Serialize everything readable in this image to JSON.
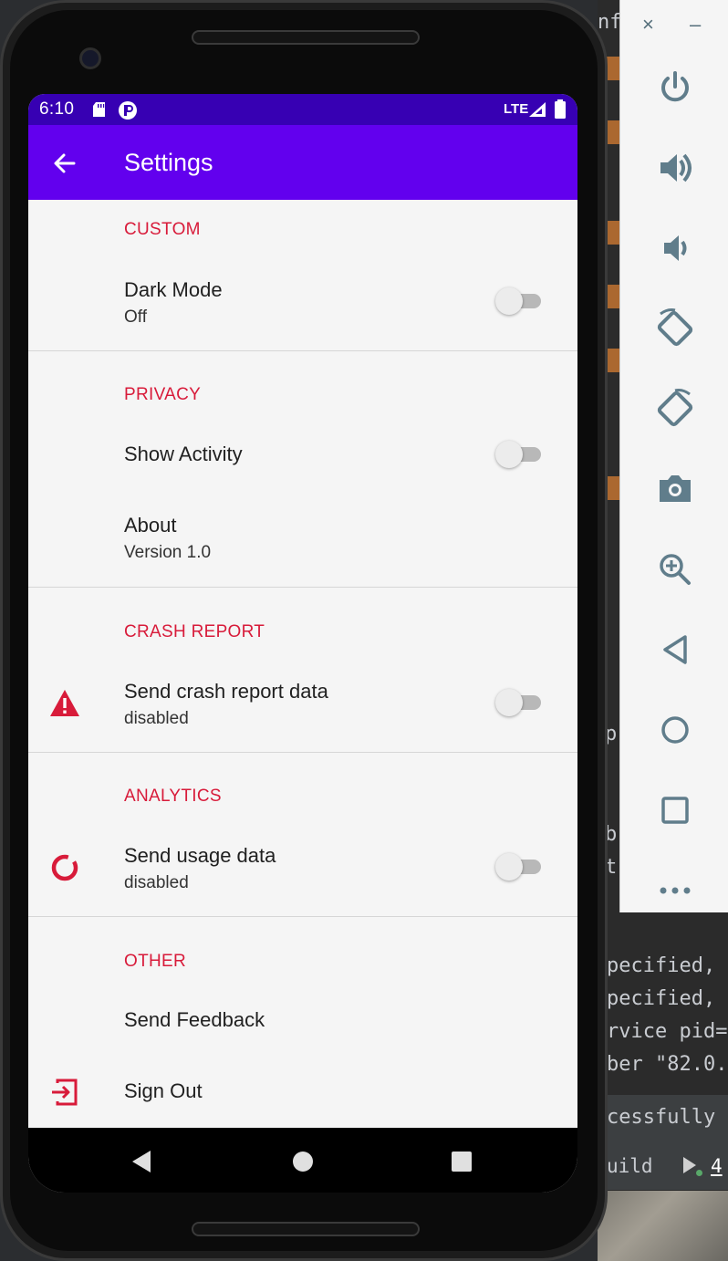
{
  "status_bar": {
    "time": "6:10",
    "network": "LTE",
    "sd_icon": "sd-card-icon",
    "app_icon": "app-notification-icon"
  },
  "app_bar": {
    "title": "Settings",
    "back_icon": "arrow-back-icon"
  },
  "settings": {
    "custom": {
      "category": "CUSTOM",
      "dark_mode": {
        "title": "Dark Mode",
        "summary": "Off",
        "enabled": false
      }
    },
    "privacy": {
      "category": "PRIVACY",
      "show_activity": {
        "title": "Show Activity",
        "enabled": false
      },
      "about": {
        "title": "About",
        "summary": "Version 1.0"
      }
    },
    "crash_report": {
      "category": "CRASH REPORT",
      "send_crash": {
        "title": "Send crash report data",
        "summary": "disabled",
        "icon": "warning-icon",
        "enabled": false
      }
    },
    "analytics": {
      "category": "ANALYTICS",
      "send_usage": {
        "title": "Send usage data",
        "summary": "disabled",
        "icon": "analytics-donut-icon",
        "enabled": false
      }
    },
    "other": {
      "category": "OTHER",
      "feedback": {
        "title": "Send Feedback"
      },
      "sign_out": {
        "title": "Sign Out",
        "icon": "sign-out-icon"
      }
    }
  },
  "nav_bar": {
    "back_icon": "nav-back-icon",
    "home_icon": "nav-home-icon",
    "recents_icon": "nav-recents-icon"
  },
  "emulator_toolbar": {
    "close_glyph": "×",
    "minimize_glyph": "–",
    "buttons": [
      "power-icon",
      "volume-up-icon",
      "volume-down-icon",
      "rotate-left-icon",
      "rotate-right-icon",
      "camera-icon",
      "zoom-icon",
      "back-icon",
      "home-icon",
      "overview-icon",
      "more-icon"
    ]
  },
  "ide_fragments": {
    "line1": "nf",
    "line2": "pecified,",
    "line3": "pecified,",
    "line4": "rvice pid=",
    "line5": "ber \"82.0.",
    "line6": "cessfully f",
    "build_tab": "uild",
    "run_tab": "4",
    "p_frag": "p",
    "b_frag": "b",
    "t_frag": "t"
  },
  "colors": {
    "status_bar": "#3700b3",
    "app_bar": "#6200ee",
    "accent": "#d81b3a",
    "background": "#f5f5f5"
  }
}
